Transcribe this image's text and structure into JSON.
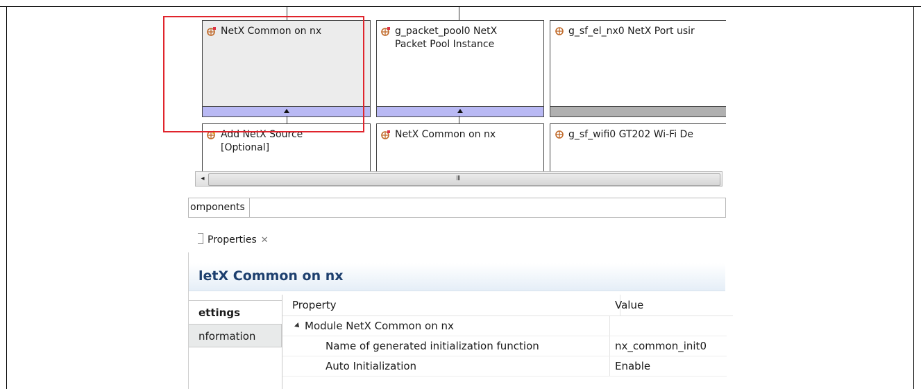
{
  "diagram": {
    "row1": [
      {
        "label": "NetX Common on nx",
        "bar": "purple",
        "arrow": true,
        "selected": true
      },
      {
        "label": "g_packet_pool0 NetX\nPacket Pool Instance",
        "bar": "purple",
        "arrow": true,
        "selected": false
      },
      {
        "label": "g_sf_el_nx0 NetX Port usir",
        "bar": "gray",
        "arrow": false,
        "selected": false
      }
    ],
    "row2": [
      {
        "label": "Add NetX Source\n[Optional]",
        "icon": "add-icon"
      },
      {
        "label": "NetX Common on nx",
        "icon": "module-icon"
      },
      {
        "label": "g_sf_wifi0 GT202 Wi-Fi De",
        "icon": "module-icon"
      }
    ],
    "scrollbar_grip": "III"
  },
  "components_tab": {
    "label": "omponents"
  },
  "properties": {
    "tab_label": "Properties",
    "close_glyph": "✕",
    "heading": "letX Common on nx",
    "side_tabs": {
      "settings": "ettings",
      "information": "nformation"
    },
    "columns": {
      "property": "Property",
      "value": "Value"
    },
    "rows": [
      {
        "property": "Module NetX Common on nx",
        "value": "",
        "indent": 1,
        "expander": true
      },
      {
        "property": "Name of generated initialization function",
        "value": "nx_common_init0",
        "indent": 2,
        "expander": false
      },
      {
        "property": "Auto Initialization",
        "value": "Enable",
        "indent": 2,
        "expander": false
      }
    ]
  },
  "colors": {
    "highlight": "#e0242c",
    "bar_purple": "#b9b9f4",
    "bar_gray": "#b0b0b0",
    "heading_text": "#1d3f6e"
  }
}
